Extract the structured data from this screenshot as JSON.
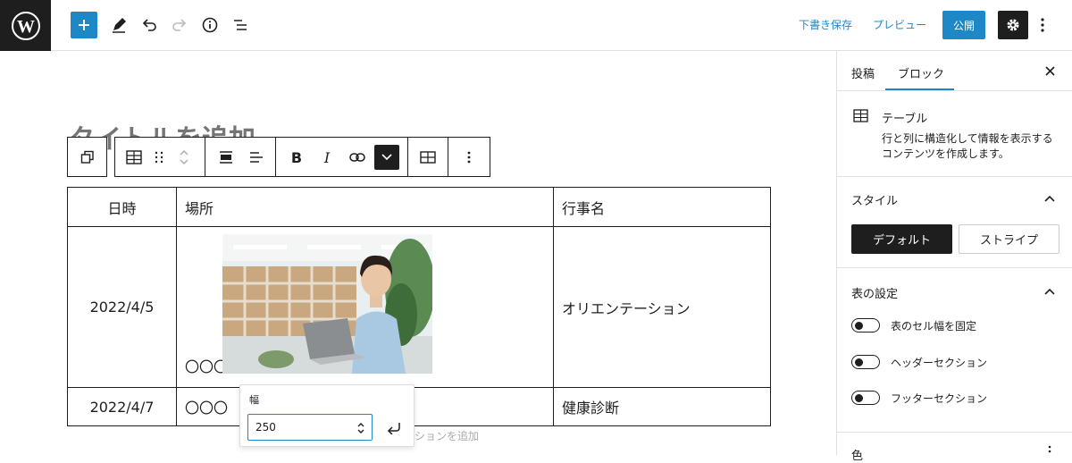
{
  "topbar": {
    "add_icon": "plus-icon",
    "tools": [
      "pencil-icon",
      "undo-icon",
      "redo-icon",
      "info-icon",
      "list-view-icon"
    ],
    "save_draft": "下書き保存",
    "preview": "プレビュー",
    "publish": "公開"
  },
  "editor": {
    "title_placeholder": "タイトルを追加",
    "caption_placeholder": "キャプションを追加"
  },
  "table": {
    "headers": [
      "日時",
      "場所",
      "行事名"
    ],
    "rows": [
      [
        "2022/4/5",
        "〇〇〇",
        "オリエンテーション"
      ],
      [
        "2022/4/7",
        "〇〇〇",
        "健康診断"
      ]
    ]
  },
  "width_popover": {
    "label": "幅",
    "value": "250"
  },
  "sidebar": {
    "tabs": [
      "投稿",
      "ブロック"
    ],
    "active_tab": "ブロック",
    "block_name": "テーブル",
    "block_desc_1": "行と列に構造化して情報を表示する",
    "block_desc_2": "コンテンツを作成します。",
    "style_title": "スタイル",
    "style_default": "デフォルト",
    "style_stripe": "ストライプ",
    "table_settings_title": "表の設定",
    "toggles": [
      "表のセル幅を固定",
      "ヘッダーセクション",
      "フッターセクション"
    ],
    "color_title": "色"
  },
  "colors": {
    "accent": "#1e88c7",
    "dark": "#1e1e1e"
  }
}
